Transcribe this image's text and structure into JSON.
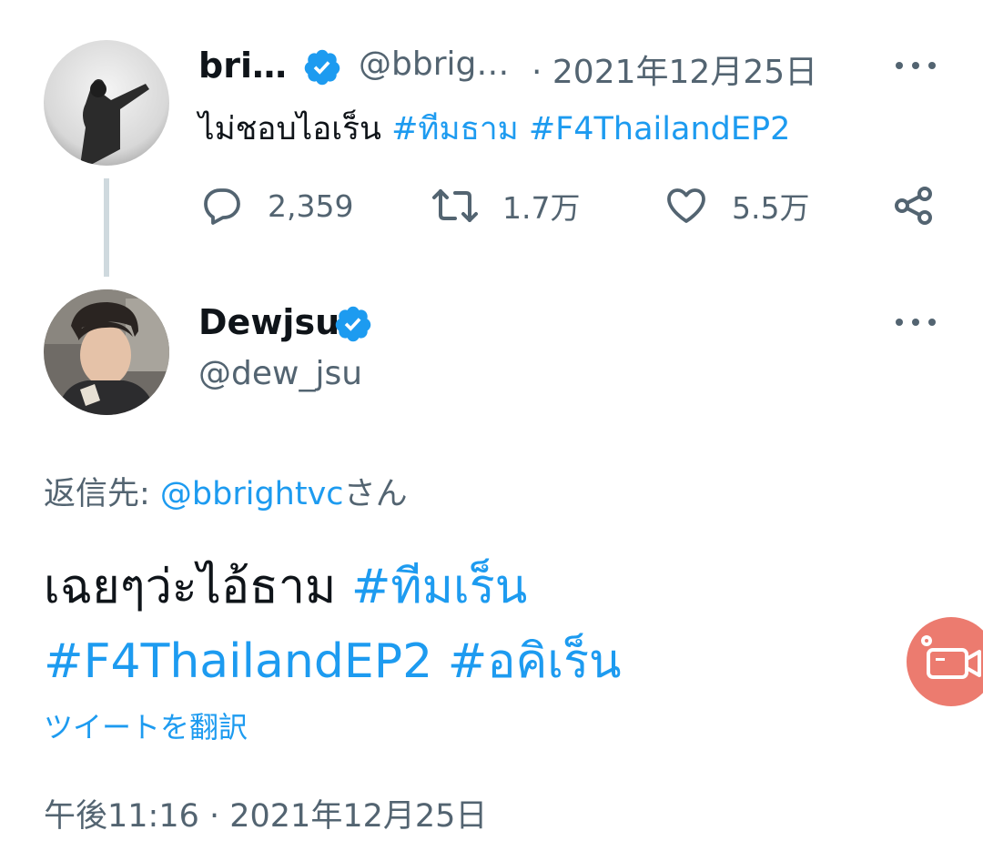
{
  "first_tweet": {
    "display_name": "bri…",
    "handle": "@bbrig…",
    "date": "· 2021年12月25日",
    "text_prefix": "ไม่ชอบไอเร็น ",
    "hashtags": [
      "#ทีมธาม",
      "#F4ThailandEP2"
    ],
    "replies_count": "2,359",
    "retweets_count": "1.7万",
    "likes_count": "5.5万"
  },
  "main_tweet": {
    "display_name": "Dewjsu",
    "handle": "@dew_jsu",
    "reply_to_label": "返信先: ",
    "reply_to_user": "@bbrightvc",
    "reply_to_suffix": "さん",
    "text_prefix": "เฉยๆว่ะไอ้ธาม ",
    "hashtags": [
      "#ทีมเร็น",
      "#F4ThailandEP2",
      "#อคิเร็น"
    ],
    "translate_label": "ツイートを翻訳",
    "timestamp": "午後11:16 · 2021年12月25日"
  },
  "colors": {
    "accent": "#1d9bf0",
    "secondary_text": "#536471",
    "fab": "#ec7b6f"
  },
  "icons": {
    "reply": "reply-icon",
    "retweet": "retweet-icon",
    "like": "heart-icon",
    "share": "share-icon",
    "verified": "verified-badge-icon",
    "more": "more-options-icon",
    "fab": "video-camera-icon"
  }
}
